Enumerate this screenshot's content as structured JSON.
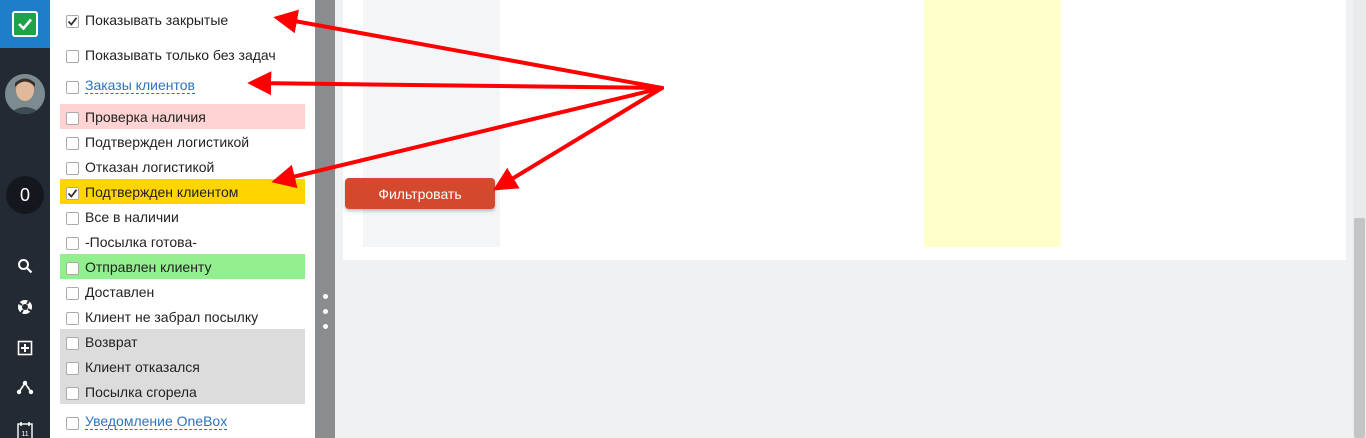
{
  "nav": {
    "counter": "0",
    "icons": [
      "search-icon",
      "lifebuoy-icon",
      "add-box-icon",
      "share-icon",
      "calendar-icon"
    ],
    "calendar_day": "11"
  },
  "filters": {
    "items": [
      {
        "label": "Показывать закрытые",
        "checked": true,
        "style": "plain"
      },
      {
        "label": "Показывать только без задач",
        "checked": false,
        "style": "plain"
      },
      {
        "label": "Заказы клиентов",
        "checked": false,
        "style": "link"
      },
      {
        "label": "Проверка наличия",
        "checked": false,
        "style": "plain",
        "bg": "#ffd3d3"
      },
      {
        "label": "Подтвержден логистикой",
        "checked": false,
        "style": "plain"
      },
      {
        "label": "Отказан логистикой",
        "checked": false,
        "style": "plain"
      },
      {
        "label": "Подтвержден клиентом",
        "checked": true,
        "style": "plain",
        "bg": "#ffd500"
      },
      {
        "label": "Все в наличии",
        "checked": false,
        "style": "plain"
      },
      {
        "label": "-Посылка готова-",
        "checked": false,
        "style": "plain"
      },
      {
        "label": "Отправлен клиенту",
        "checked": false,
        "style": "plain",
        "bg": "#92ef8e"
      },
      {
        "label": "Доставлен",
        "checked": false,
        "style": "plain"
      },
      {
        "label": "Клиент не забрал посылку",
        "checked": false,
        "style": "plain"
      },
      {
        "label": "Возврат",
        "checked": false,
        "style": "plain",
        "bg": "#dcdcdc"
      },
      {
        "label": "Клиент отказался",
        "checked": false,
        "style": "plain",
        "bg": "#dcdcdc"
      },
      {
        "label": "Посылка сгорела",
        "checked": false,
        "style": "plain",
        "bg": "#dcdcdc"
      },
      {
        "label": "Уведомление OneBox",
        "checked": false,
        "style": "link"
      }
    ]
  },
  "main": {
    "filter_button": "Фильтровать"
  },
  "colors": {
    "nav_bg": "#232a33",
    "logo_bg": "#1e7fc8",
    "button_bg": "#d3492d",
    "arrow": "#ff0000",
    "link": "#2a73c0"
  }
}
